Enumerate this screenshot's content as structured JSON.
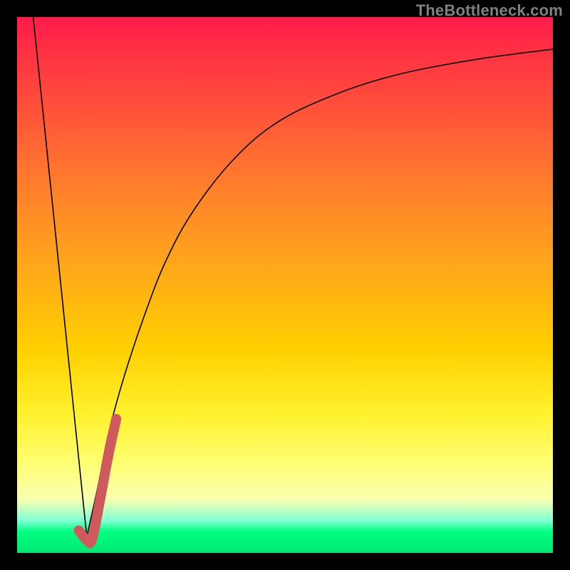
{
  "watermark": "TheBottleneck.com",
  "accent_color": "#cf5a5e",
  "curve_color": "#000000",
  "chart_data": {
    "type": "line",
    "title": "",
    "xlabel": "",
    "ylabel": "",
    "xlim": [
      0,
      100
    ],
    "ylim": [
      0,
      100
    ],
    "series": [
      {
        "name": "left-descent",
        "x": [
          3,
          13
        ],
        "values": [
          100,
          3
        ]
      },
      {
        "name": "log-curve",
        "x": [
          13,
          15,
          17,
          20,
          24,
          28,
          33,
          40,
          48,
          58,
          70,
          85,
          100
        ],
        "values": [
          3,
          12,
          22,
          33,
          45,
          55,
          64,
          73,
          80,
          85,
          89,
          92,
          94
        ]
      },
      {
        "name": "accent-j",
        "x": [
          11.5,
          13.0,
          14.0,
          15.5,
          17.0,
          18.5
        ],
        "values": [
          4.2,
          2.4,
          2.6,
          10.0,
          18.0,
          25.0
        ]
      }
    ]
  }
}
